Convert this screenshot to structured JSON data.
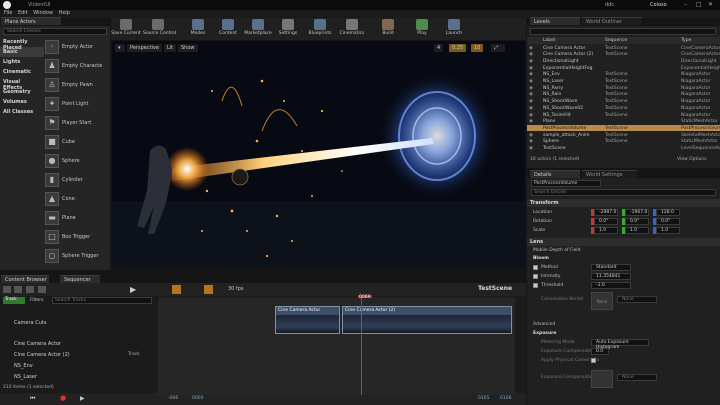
{
  "window": {
    "title": "ViolentUI",
    "right_label": "Coloso",
    "quick_label": "ddc"
  },
  "menu": [
    "File",
    "Edit",
    "Window",
    "Help"
  ],
  "place_actors": {
    "tab": "Place Actors",
    "search_placeholder": "Search Classes",
    "categories": [
      "Recently Placed",
      "Basic",
      "Lights",
      "Cinematic",
      "Visual Effects",
      "Geometry",
      "Volumes",
      "All Classes"
    ],
    "selected_category": "Basic",
    "items": [
      "Empty Actor",
      "Empty Characte",
      "Empty Pawn",
      "Point Light",
      "Player Start",
      "Cube",
      "Sphere",
      "Cylinder",
      "Cone",
      "Plane",
      "Box Trigger",
      "Sphere Trigger"
    ]
  },
  "toolbar": [
    "Save Current",
    "Source Control",
    "Modes",
    "Content",
    "Marketplace",
    "Settings",
    "Blueprints",
    "Cinematics",
    "Build",
    "Play",
    "Launch"
  ],
  "viewport": {
    "perspective": "Perspective",
    "lit": "Lit",
    "show": "Show",
    "speed": "4",
    "fov": "0.25",
    "snap": "10"
  },
  "outliner": {
    "tabs": [
      "Levels",
      "World Outliner"
    ],
    "headers": [
      "Label",
      "Sequence",
      "Type"
    ],
    "rows": [
      {
        "label": "Cine Camera Actor",
        "seq": "TestScene",
        "type": "CineCameraActor"
      },
      {
        "label": "Cine Camera Actor (2)",
        "seq": "TestScene",
        "type": "CineCameraActor"
      },
      {
        "label": "DirectionalLight",
        "seq": "",
        "type": "DirectionalLight"
      },
      {
        "label": "ExponentialHeightFog",
        "seq": "",
        "type": "ExponentialHeightFog"
      },
      {
        "label": "NS_Env",
        "seq": "TestScene",
        "type": "NiagaraActor"
      },
      {
        "label": "NS_Laser",
        "seq": "TestScene",
        "type": "NiagaraActor"
      },
      {
        "label": "NS_Parry",
        "seq": "TestScene",
        "type": "NiagaraActor"
      },
      {
        "label": "NS_Rain",
        "seq": "TestScene",
        "type": "NiagaraActor"
      },
      {
        "label": "NS_ShockWave",
        "seq": "TestScene",
        "type": "NiagaraActor"
      },
      {
        "label": "NS_ShockWave02",
        "seq": "TestScene",
        "type": "NiagaraActor"
      },
      {
        "label": "NS_TosimHit",
        "seq": "TestScene",
        "type": "NiagaraActor"
      },
      {
        "label": "Plane",
        "seq": "",
        "type": "StaticMeshActor"
      },
      {
        "label": "PostProcessVolume",
        "seq": "TestScene",
        "type": "PostProcessVolume"
      },
      {
        "label": "sample_attack_Anim",
        "seq": "TestScene",
        "type": "SkeletalMeshActor"
      },
      {
        "label": "Sphere",
        "seq": "TestScene",
        "type": "StaticMeshActor"
      },
      {
        "label": "TestScene",
        "seq": "",
        "type": "LevelSequenceActor"
      }
    ],
    "selected_index": 12,
    "footer": "16 actors (1 selected)",
    "view_options": "View Options"
  },
  "details": {
    "tabs": [
      "Details",
      "World Settings"
    ],
    "actor_name": "PostProcessVolume",
    "search_placeholder": "Search Details",
    "transform_label": "Transform",
    "location": {
      "label": "Location",
      "x": "-2987.0",
      "y": "-1967.0",
      "z": "128.0"
    },
    "rotation": {
      "label": "Rotation",
      "x": "0.0°",
      "y": "0.0°",
      "z": "0.0°"
    },
    "scale": {
      "label": "Scale",
      "x": "1.0",
      "y": "1.0",
      "z": "1.0"
    },
    "lens_label": "Lens",
    "mobile_dof": "Mobile Depth of Field",
    "bloom_label": "Bloom",
    "bloom_method": {
      "label": "Method",
      "value": "Standard"
    },
    "bloom_intensity": {
      "label": "Intensity",
      "value": "11.354841"
    },
    "bloom_threshold": {
      "label": "Threshold",
      "value": "-1.0"
    },
    "convolution": "Convolution Kernel",
    "kernel_none": "None",
    "advanced": "Advanced",
    "exposure_label": "Exposure",
    "metering": {
      "label": "Metering Mode",
      "value": "Auto Exposure Histogram"
    },
    "exp_comp": {
      "label": "Exposure Compensation",
      "value": "0.0"
    },
    "apply_physical": "Apply Physical Camera Ex",
    "exp_curve": "Exposure Compensation C",
    "curve_none": "None"
  },
  "bottom": {
    "tabs": [
      "Content Browser",
      "Sequencer"
    ],
    "track_btn": "Track",
    "filters": "Filters",
    "search_placeholder": "Search Tracks",
    "fps": "30 fps",
    "sequence_name": "TestScene",
    "current_frame": "0069",
    "tracks": [
      "Camera Cuts",
      "Cine Camera Actor",
      "Cine Camera Actor (2)",
      "NS_Env",
      "NS_Laser"
    ],
    "track_add": "Track",
    "footer": "210 items (1 selected)",
    "start": "0000",
    "start2": "-006",
    "end": "0165",
    "end2": "0166",
    "clips": [
      "Cine Camera Actor",
      "Cine Camera Actor (2)"
    ]
  }
}
